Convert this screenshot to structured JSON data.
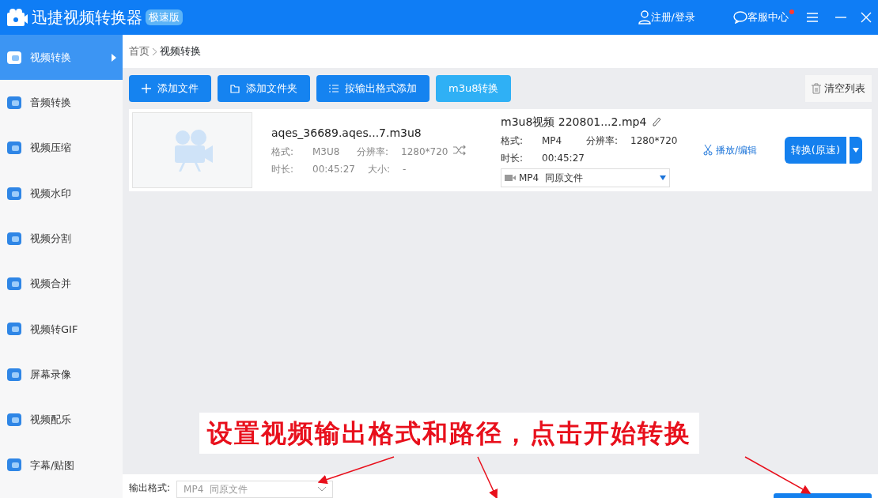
{
  "window": {
    "title": "迅捷视频转换器",
    "badge": "极速版",
    "login": "注册/登录",
    "service": "客服中心",
    "service_notice": true
  },
  "sidebar": {
    "items": [
      {
        "label": "视频转换",
        "selected": true
      },
      {
        "label": "音频转换",
        "selected": false
      },
      {
        "label": "视频压缩",
        "selected": false
      },
      {
        "label": "视频水印",
        "selected": false
      },
      {
        "label": "视频分割",
        "selected": false
      },
      {
        "label": "视频合并",
        "selected": false
      },
      {
        "label": "视频转GIF",
        "selected": false
      },
      {
        "label": "屏幕录像",
        "selected": false
      },
      {
        "label": "视频配乐",
        "selected": false
      },
      {
        "label": "字幕/贴图",
        "selected": false
      }
    ]
  },
  "breadcrumb": [
    "首页",
    "视频转换"
  ],
  "toolbar": {
    "buttons": [
      {
        "label": "添加文件",
        "kind": "add"
      },
      {
        "label": "添加文件夹",
        "kind": "folder"
      },
      {
        "label": "按输出格式添加",
        "kind": "list"
      },
      {
        "label": "m3u8转换",
        "kind": "plain"
      }
    ],
    "clear": "清空列表"
  },
  "files": [
    {
      "source": {
        "name": "aqes_36689.aqes...7.m3u8",
        "format_label": "格式:",
        "format": "M3U8",
        "resolution_label": "分辨率:",
        "resolution": "1280*720",
        "duration_label": "时长:",
        "duration": "00:45:27",
        "size_label": "大小:",
        "size": "-"
      },
      "target": {
        "name": "m3u8视频 220801...2.mp4",
        "format_label": "格式:",
        "format": "MP4",
        "resolution_label": "分辨率:",
        "resolution": "1280*720",
        "duration_label": "时长:",
        "duration": "00:45:27",
        "output_format": "MP4",
        "output_path": "同原文件"
      },
      "edit": "播放/编辑",
      "convert": "转换(原速)"
    }
  ],
  "annotation": "设置视频输出格式和路径，点击开始转换",
  "bottom": {
    "format_label": "输出格式:",
    "format_value": "MP4  同原文件"
  }
}
